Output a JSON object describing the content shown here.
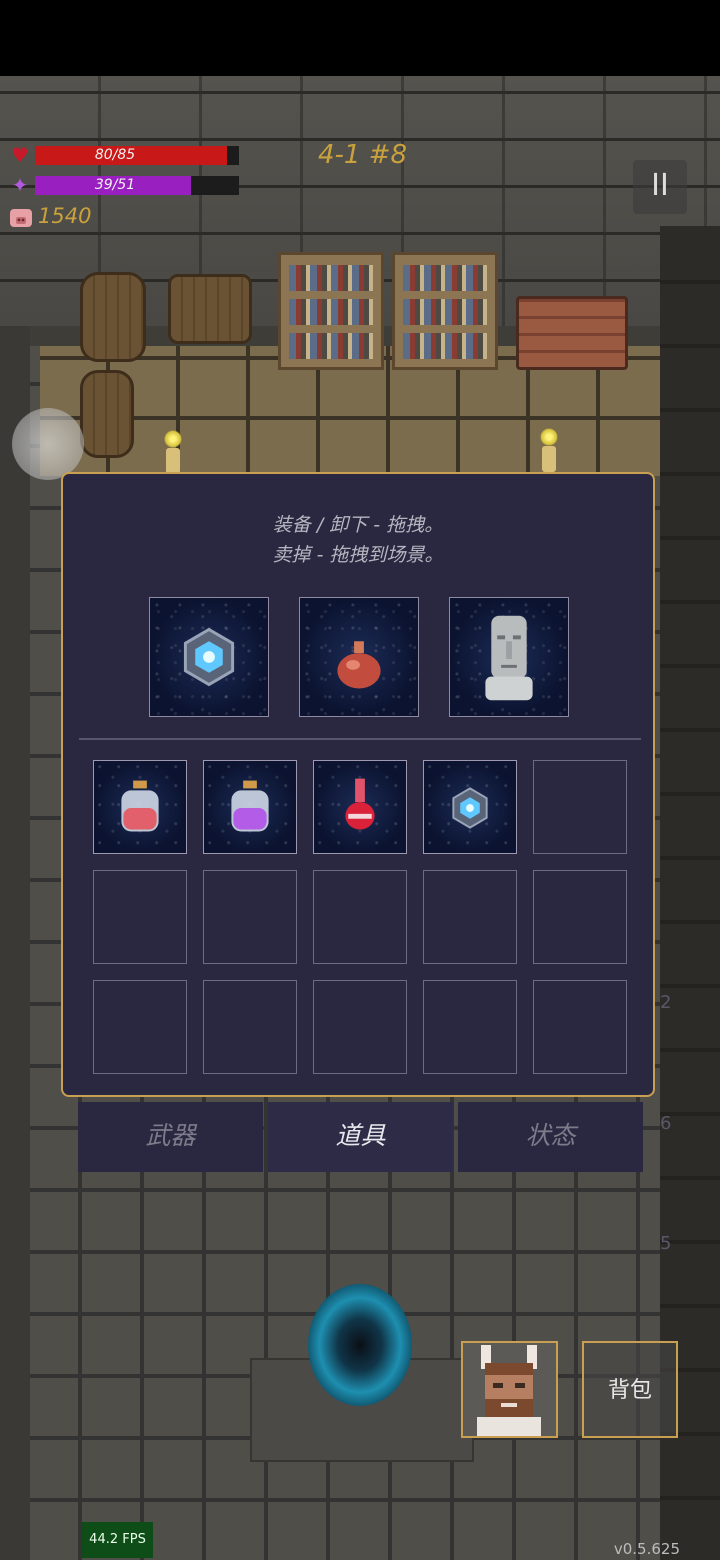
{
  "hud": {
    "hp_text": "80/85",
    "hp_fraction": 0.941,
    "mp_text": "39/51",
    "mp_fraction": 0.765,
    "gold": "1540",
    "level": "4-1 #8",
    "pause_label": "II",
    "colors": {
      "hp": "#c81818",
      "mp": "#9a1fc0",
      "gold": "#c9a23e"
    }
  },
  "inventory": {
    "hint_line1": "装备 / 卸下 - 拖拽。",
    "hint_line2": "卖掉 - 拖拽到场景。",
    "equipped": [
      {
        "icon": "crystal-orb-icon"
      },
      {
        "icon": "red-pouch-icon"
      },
      {
        "icon": "stone-head-icon"
      }
    ],
    "grid_items": [
      {
        "icon": "health-potion-icon"
      },
      {
        "icon": "mana-potion-icon"
      },
      {
        "icon": "red-flask-icon"
      },
      {
        "icon": "crystal-orb-icon"
      }
    ]
  },
  "tabs": [
    {
      "label": "武器",
      "active": false
    },
    {
      "label": "道具",
      "active": true
    },
    {
      "label": "状态",
      "active": false
    }
  ],
  "side": {
    "num_a": "2",
    "num_b": "6",
    "num_c": "5"
  },
  "buttons": {
    "bag_label": "背包"
  },
  "debug": {
    "fps": "44.2 FPS",
    "version": "v0.5.625"
  }
}
